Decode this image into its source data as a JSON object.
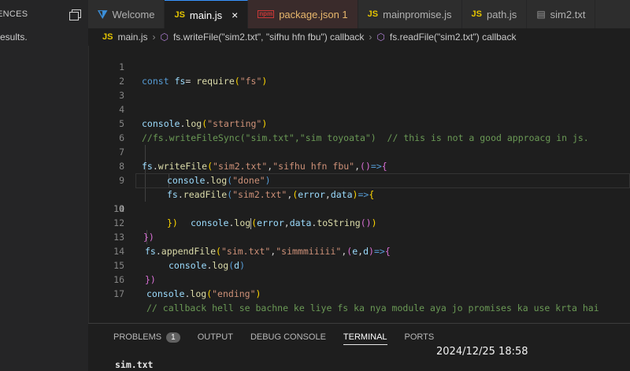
{
  "sidebar": {
    "header": "ENCES",
    "item": "esults."
  },
  "tabs": [
    {
      "icon": "vscode",
      "label": "Welcome",
      "state": "normal"
    },
    {
      "icon": "JS",
      "label": "main.js",
      "state": "active"
    },
    {
      "icon": "npm",
      "label": "package.json 1",
      "state": "modified"
    },
    {
      "icon": "JS",
      "label": "mainpromise.js",
      "state": "normal"
    },
    {
      "icon": "JS",
      "label": "path.js",
      "state": "normal"
    },
    {
      "icon": "file",
      "label": "sim2.txt",
      "state": "normal"
    }
  ],
  "icons": {
    "close": "×",
    "js": "JS",
    "vscode": "⧩",
    "npm": "npm",
    "file": "▤",
    "cube": "⬡",
    "chevron": "›"
  },
  "breadcrumb": {
    "file": "main.js",
    "seg1": "fs.writeFile(\"sim2.txt\", \"sifhu hfn fbu\") callback",
    "seg2": "fs.readFile(\"sim2.txt\") callback"
  },
  "editor": {
    "lines": [
      {
        "n": "1",
        "t": "const fs= require(\"fs\")"
      },
      {
        "n": "2",
        "t": ""
      },
      {
        "n": "3",
        "t": ""
      },
      {
        "n": "4",
        "t": "console.log(\"starting\")"
      },
      {
        "n": "5",
        "t": "//fs.writeFileSync(\"sim.txt\",\"sim toyoata\")  // this is not a good approacg in js."
      },
      {
        "n": "6",
        "t": ""
      },
      {
        "n": "7",
        "t": "fs.writeFile(\"sim2.txt\",\"sifhu hfn fbu\",()=>{"
      },
      {
        "n": "8",
        "t": "console.log(\"done\")"
      },
      {
        "n": "9",
        "t": "fs.readFile(\"sim2.txt\",(error,data)=>{"
      },
      {
        "n": "10",
        "t": "console.log(error,data.toString())"
      },
      {
        "n": "11",
        "t": "})"
      },
      {
        "n": "12",
        "t": "})"
      },
      {
        "n": "13",
        "t": "fs.appendFile(\"sim.txt\",\"simmmiiiii\",(e,d)=>{"
      },
      {
        "n": "14",
        "t": "console.log(d)"
      },
      {
        "n": "15",
        "t": "})"
      },
      {
        "n": "16",
        "t": "console.log(\"ending\")"
      },
      {
        "n": "17",
        "t": "// callback hell se bachne ke liye fs ka nya module aya jo promises ka use krta hai"
      }
    ]
  },
  "panel": {
    "tabs": [
      "PROBLEMS",
      "OUTPUT",
      "DEBUG CONSOLE",
      "TERMINAL",
      "PORTS"
    ],
    "problems_count": "1",
    "active": "TERMINAL",
    "terminal_line": "sim.txt"
  },
  "photo_timestamp": "2024/12/25 18:58",
  "colors": {
    "accent": "#3794ff",
    "keyword": "#569cd6",
    "string": "#ce9178",
    "comment": "#6a9955",
    "function": "#dcdcaa",
    "variable": "#9cdcfe"
  }
}
